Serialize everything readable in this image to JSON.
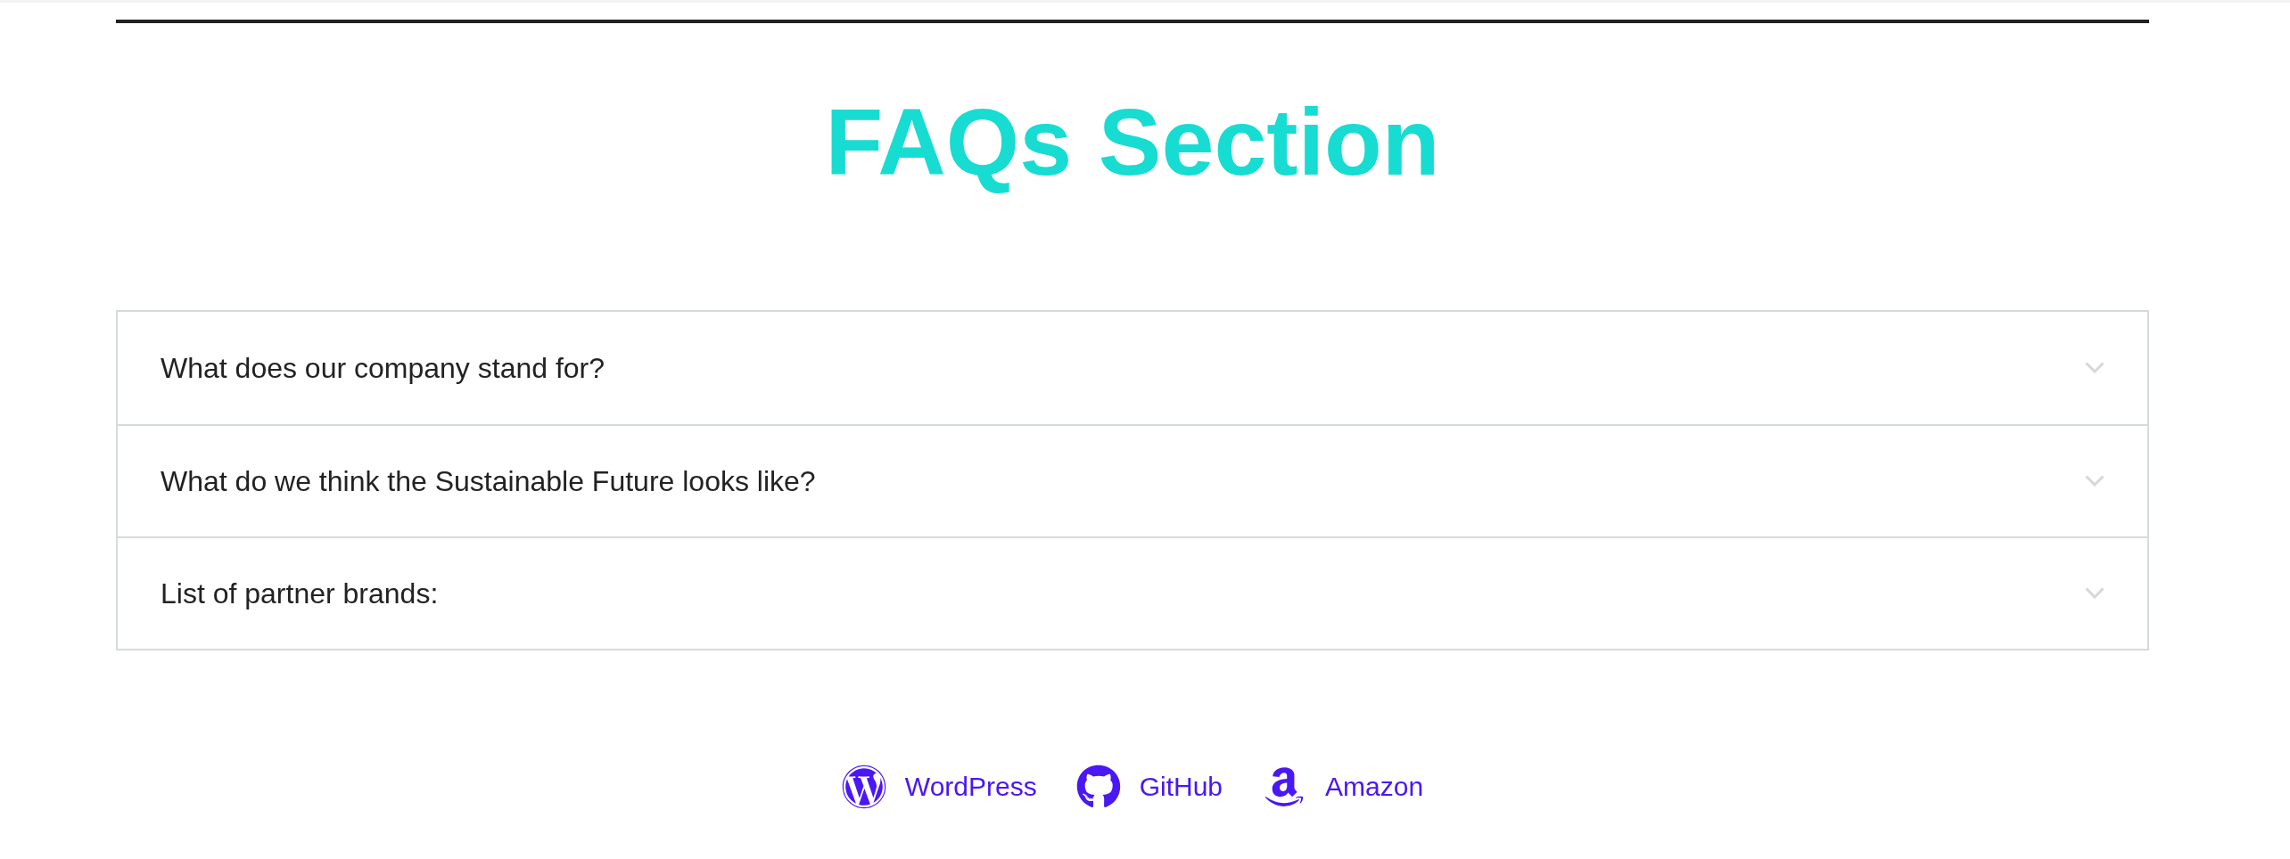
{
  "title": "FAQs Section",
  "faqs": [
    {
      "question": "What does our company stand for?",
      "expanded": false
    },
    {
      "question": "What do we think the Sustainable Future looks like?",
      "expanded": false
    },
    {
      "question": "List of partner brands:",
      "expanded": false
    }
  ],
  "links": [
    {
      "label": "WordPress"
    },
    {
      "label": "GitHub"
    },
    {
      "label": "Amazon"
    }
  ]
}
